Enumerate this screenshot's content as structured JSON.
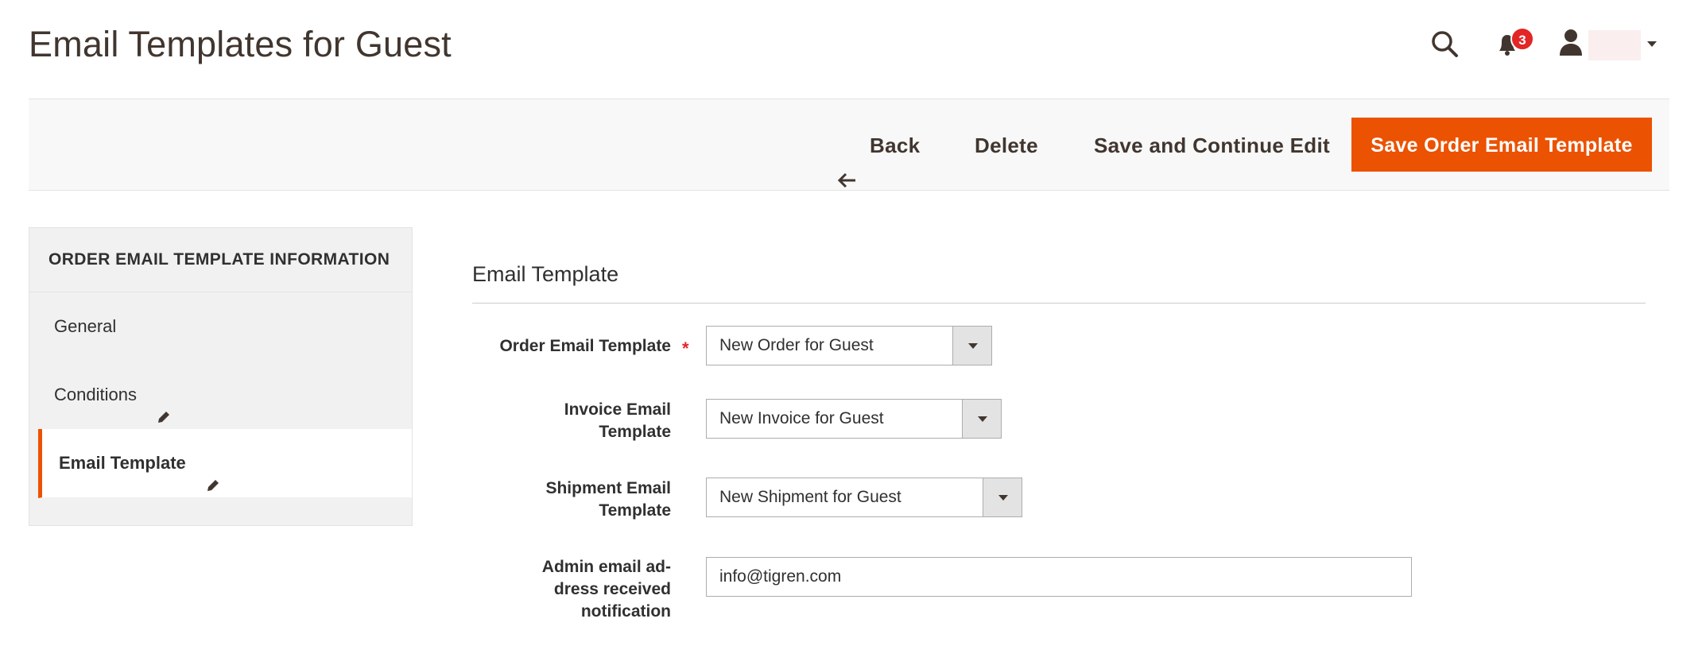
{
  "page": {
    "title": "Email Templates for Guest"
  },
  "header": {
    "notifications_count": "3",
    "icons": {
      "search": "search-icon",
      "notifications": "bell-icon",
      "user": "user-icon",
      "menu": "chevron-down-icon"
    }
  },
  "actions": {
    "back_label": "Back",
    "delete_label": "Delete",
    "save_continue_label": "Save and Continue Edit",
    "save_primary_label": "Save Order Email Template"
  },
  "sidebar": {
    "heading": "ORDER EMAIL TEMPLATE INFORMATION",
    "items": [
      {
        "label": "General",
        "edited": false,
        "active": false
      },
      {
        "label": "Conditions",
        "edited": true,
        "active": false
      },
      {
        "label": "Email Template",
        "edited": true,
        "active": true
      }
    ]
  },
  "section": {
    "title": "Email Template"
  },
  "form": {
    "order_template": {
      "label": "Order Email Template",
      "required": true,
      "value": "New Order for Guest"
    },
    "invoice_template": {
      "label_line1": "Invoice Email",
      "label_line2": "Template",
      "value": "New Invoice for Guest"
    },
    "shipment_template": {
      "label_line1": "Shipment Email",
      "label_line2": "Template",
      "value": "New Shipment for Guest"
    },
    "admin_email": {
      "label_line1": "Admin email ad-",
      "label_line2": "dress received",
      "label_line3": "notification",
      "value": "info@tigren.com"
    }
  },
  "colors": {
    "accent": "#eb5202",
    "badge": "#e22626",
    "text": "#303030",
    "title": "#41362f"
  }
}
